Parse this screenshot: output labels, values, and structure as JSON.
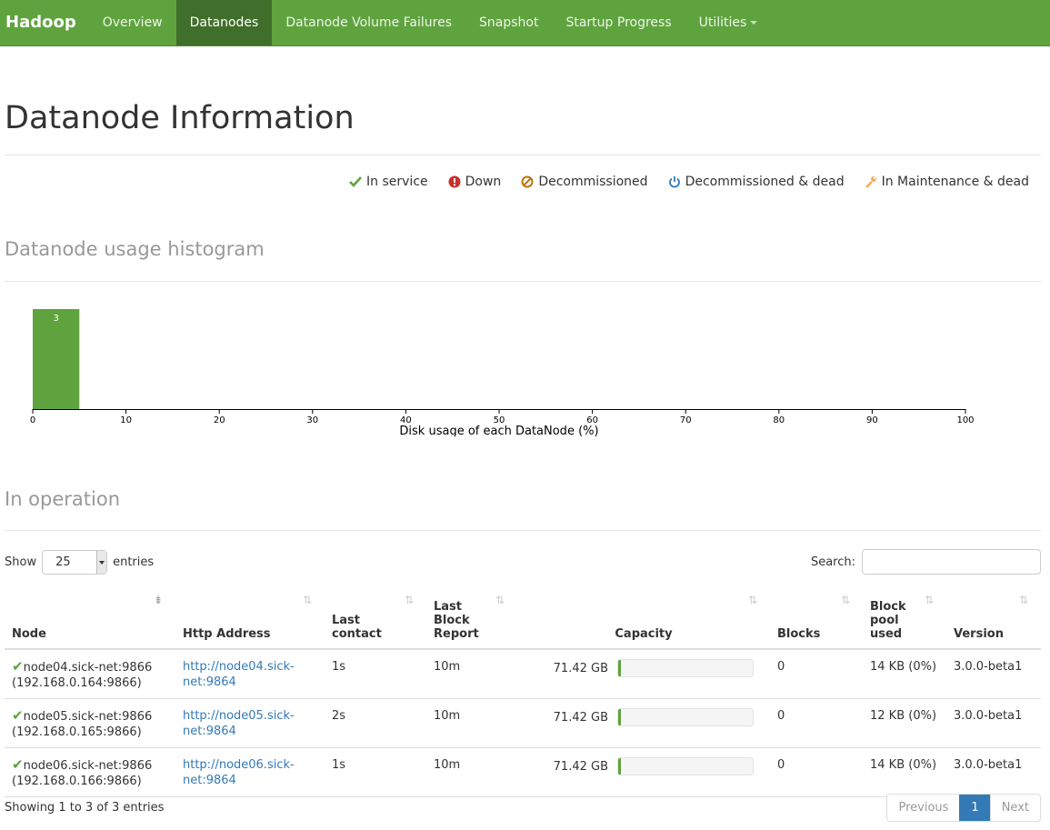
{
  "nav": {
    "brand": "Hadoop",
    "items": [
      "Overview",
      "Datanodes",
      "Datanode Volume Failures",
      "Snapshot",
      "Startup Progress",
      "Utilities"
    ],
    "active": "Datanodes"
  },
  "page_title": "Datanode Information",
  "legend": [
    {
      "label": "In service",
      "icon": "check-icon",
      "color": "#5fa33e"
    },
    {
      "label": "Down",
      "icon": "exclamation-circle-icon",
      "color": "#c9302c"
    },
    {
      "label": "Decommissioned",
      "icon": "ban-icon",
      "color": "#c0730d"
    },
    {
      "label": "Decommissioned & dead",
      "icon": "power-icon",
      "color": "#337ab7"
    },
    {
      "label": "In Maintenance & dead",
      "icon": "wrench-icon",
      "color": "#f0ad4e"
    }
  ],
  "histogram_title": "Datanode usage histogram",
  "chart_data": {
    "type": "bar",
    "bins": [
      [
        0,
        5
      ]
    ],
    "values": [
      3
    ],
    "xlabel": "Disk usage of each DataNode (%)",
    "xticks": [
      "0",
      "10",
      "20",
      "30",
      "40",
      "50",
      "60",
      "70",
      "80",
      "90",
      "100"
    ],
    "xlim": [
      0,
      100
    ],
    "ylim": [
      0,
      3
    ],
    "color": "#5fa33e"
  },
  "operation_title": "In operation",
  "table_controls": {
    "show_label": "Show",
    "entries_value": "25",
    "entries_label": "entries",
    "search_label": "Search:"
  },
  "columns": [
    "Node",
    "Http Address",
    "Last contact",
    "Last Block Report",
    "Capacity",
    "Blocks",
    "Block pool used",
    "Version"
  ],
  "rows": [
    {
      "node": "node04.sick-net:9866",
      "ip": "(192.168.0.164:9866)",
      "http": "http://node04.sick-net:9864",
      "last_contact": "1s",
      "last_block_report": "10m",
      "capacity": "71.42 GB",
      "used_fraction": 0.02,
      "blocks": "0",
      "pool_used": "14 KB (0%)",
      "version": "3.0.0-beta1"
    },
    {
      "node": "node05.sick-net:9866",
      "ip": "(192.168.0.165:9866)",
      "http": "http://node05.sick-net:9864",
      "last_contact": "2s",
      "last_block_report": "10m",
      "capacity": "71.42 GB",
      "used_fraction": 0.02,
      "blocks": "0",
      "pool_used": "12 KB (0%)",
      "version": "3.0.0-beta1"
    },
    {
      "node": "node06.sick-net:9866",
      "ip": "(192.168.0.166:9866)",
      "http": "http://node06.sick-net:9864",
      "last_contact": "1s",
      "last_block_report": "10m",
      "capacity": "71.42 GB",
      "used_fraction": 0.02,
      "blocks": "0",
      "pool_used": "14 KB (0%)",
      "version": "3.0.0-beta1"
    }
  ],
  "footer": {
    "info": "Showing 1 to 3 of 3 entries",
    "previous": "Previous",
    "page": "1",
    "next": "Next"
  }
}
